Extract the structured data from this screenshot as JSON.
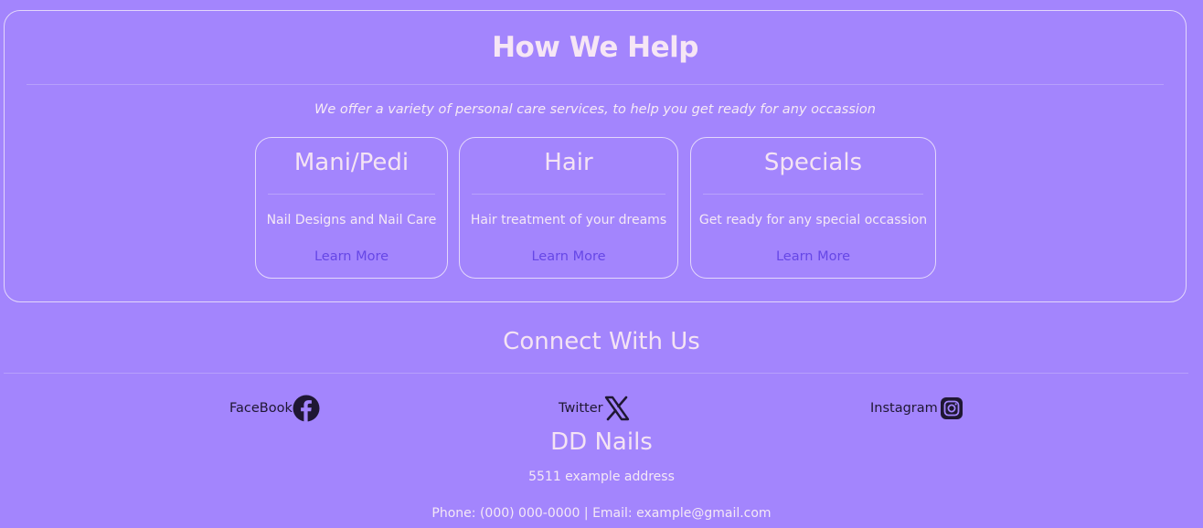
{
  "help": {
    "title": "How We Help",
    "subtitle": "We offer a variety of personal care services, to help you get ready for any occassion",
    "cards": [
      {
        "title": "Mani/Pedi",
        "description": "Nail Designs and Nail Care",
        "link": "Learn More"
      },
      {
        "title": "Hair",
        "description": "Hair treatment of your dreams",
        "link": "Learn More"
      },
      {
        "title": "Specials",
        "description": "Get ready for any special occassion",
        "link": "Learn More"
      }
    ]
  },
  "connect": {
    "title": "Connect With Us",
    "socials": [
      {
        "label": "FaceBook",
        "icon": "facebook-icon"
      },
      {
        "label": "Twitter",
        "icon": "x-twitter-icon"
      },
      {
        "label": "Instagram",
        "icon": "instagram-icon"
      }
    ]
  },
  "footer": {
    "brand": "DD Nails",
    "address": "5511 example address",
    "contact": "Phone: (000) 000-0000 | Email: example@gmail.com"
  },
  "colors": {
    "background": "#a385fd",
    "link": "#6647e6",
    "heading": "#f4e3f4",
    "icon": "#1f1733"
  }
}
